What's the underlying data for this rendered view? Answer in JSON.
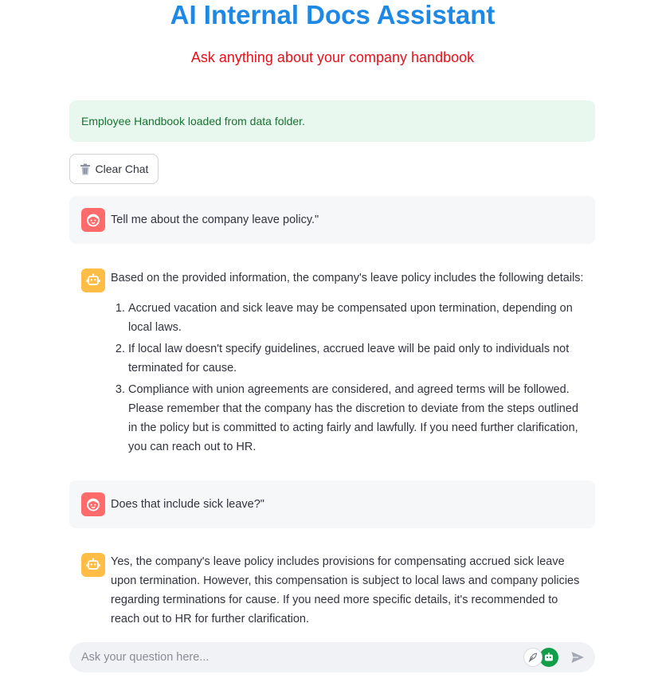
{
  "header": {
    "title": "AI Internal Docs Assistant",
    "subtitle": "Ask anything about your company handbook"
  },
  "status": {
    "success_message": "Employee Handbook loaded from data folder."
  },
  "toolbar": {
    "clear_label": "Clear Chat",
    "clear_icon": "trash-icon"
  },
  "messages": [
    {
      "role": "user",
      "text": "Tell me about the company leave policy.\""
    },
    {
      "role": "assistant",
      "intro": "Based on the provided information, the company's leave policy includes the following details:",
      "list": [
        "Accrued vacation and sick leave may be compensated upon termination, depending on local laws.",
        "If local law doesn't specify guidelines, accrued leave will be paid only to individuals not terminated for cause.",
        "Compliance with union agreements are considered, and agreed terms will be followed. Please remember that the company has the discretion to deviate from the steps outlined in the policy but is committed to acting fairly and lawfully. If you need further clarification, you can reach out to HR."
      ]
    },
    {
      "role": "user",
      "text": "Does that include sick leave?\""
    },
    {
      "role": "assistant",
      "text": "Yes, the company's leave policy includes provisions for compensating accrued sick leave upon termination. However, this compensation is subject to local laws and company policies regarding terminations for cause. If you need more specific details, it's recommended to reach out to HR for further clarification."
    }
  ],
  "chat_input": {
    "placeholder": "Ask your question here..."
  },
  "colors": {
    "title": "#1e88e5",
    "subtitle": "#e8101b",
    "success_bg": "#e9f8ee",
    "success_text": "#177233",
    "user_avatar": "#ff6b6b",
    "assistant_avatar": "#ffbd45",
    "user_message_bg": "#f6f7f9"
  }
}
